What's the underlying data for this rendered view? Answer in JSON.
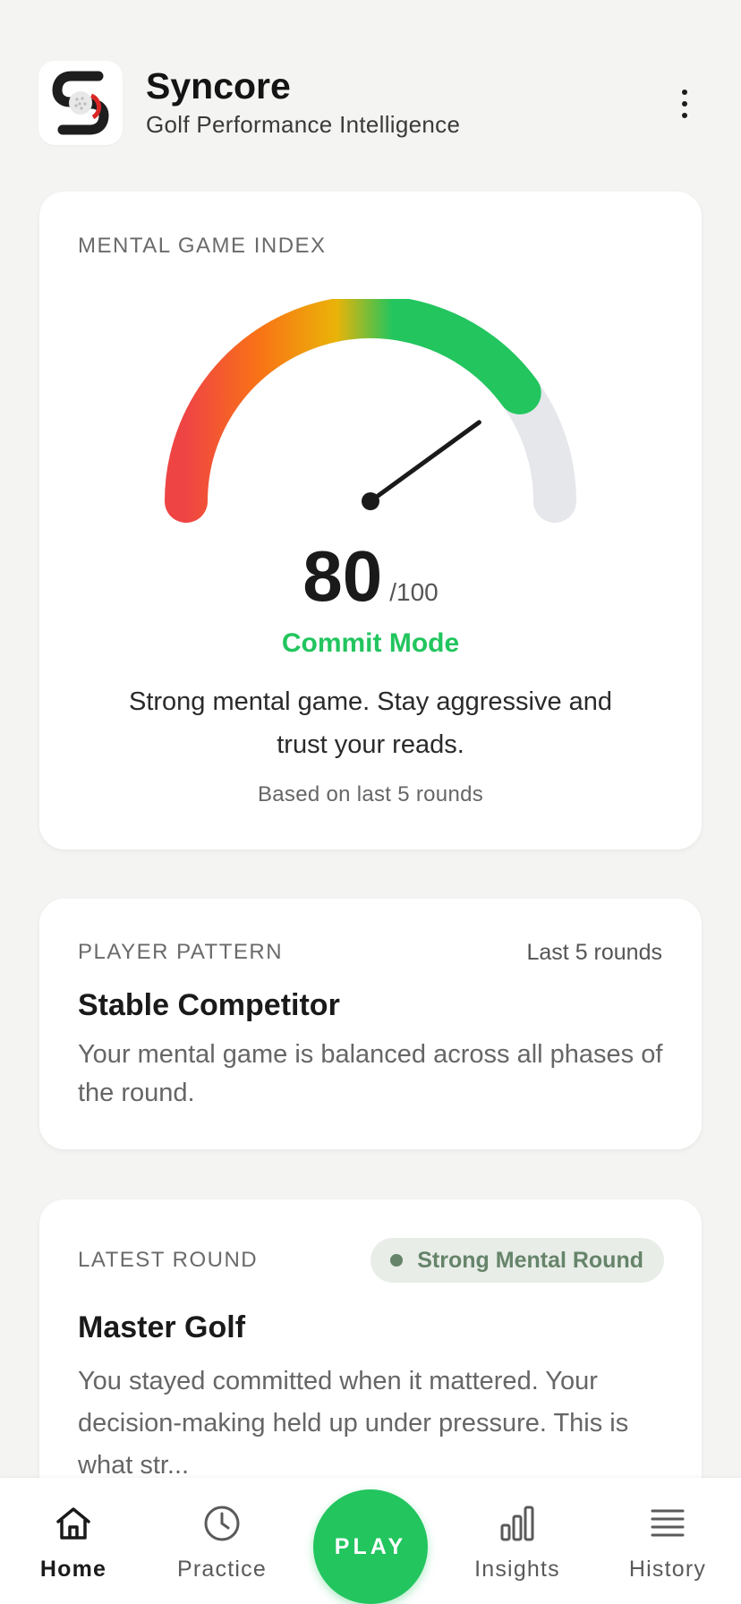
{
  "header": {
    "title": "Syncore",
    "subtitle": "Golf Performance Intelligence",
    "logo_icon": "syncore-logo",
    "menu_icon": "more-vertical-icon"
  },
  "mental_index": {
    "label": "MENTAL GAME INDEX",
    "score": "80",
    "max": "/100",
    "score_value": 80,
    "mode": "Commit Mode",
    "description": "Strong mental game. Stay aggressive and trust your reads.",
    "footnote": "Based on last 5 rounds",
    "gauge_colors": {
      "low": "#ef4444",
      "mid": "#eab308",
      "high": "#22c55e",
      "track": "#e5e7eb"
    }
  },
  "player_pattern": {
    "label": "PLAYER PATTERN",
    "range": "Last 5 rounds",
    "title": "Stable Competitor",
    "description": "Your mental game is balanced across all phases of the round."
  },
  "latest_round": {
    "label": "LATEST ROUND",
    "badge": "Strong Mental Round",
    "title": "Master Golf",
    "description": "You stayed committed when it mattered. Your decision-making held up under pressure. This is what str..."
  },
  "nav": {
    "home": "Home",
    "practice": "Practice",
    "play": "PLAY",
    "insights": "Insights",
    "history": "History",
    "active": "home"
  },
  "colors": {
    "accent": "#22c55e",
    "background": "#f4f4f2",
    "badge_text": "#66846a"
  }
}
